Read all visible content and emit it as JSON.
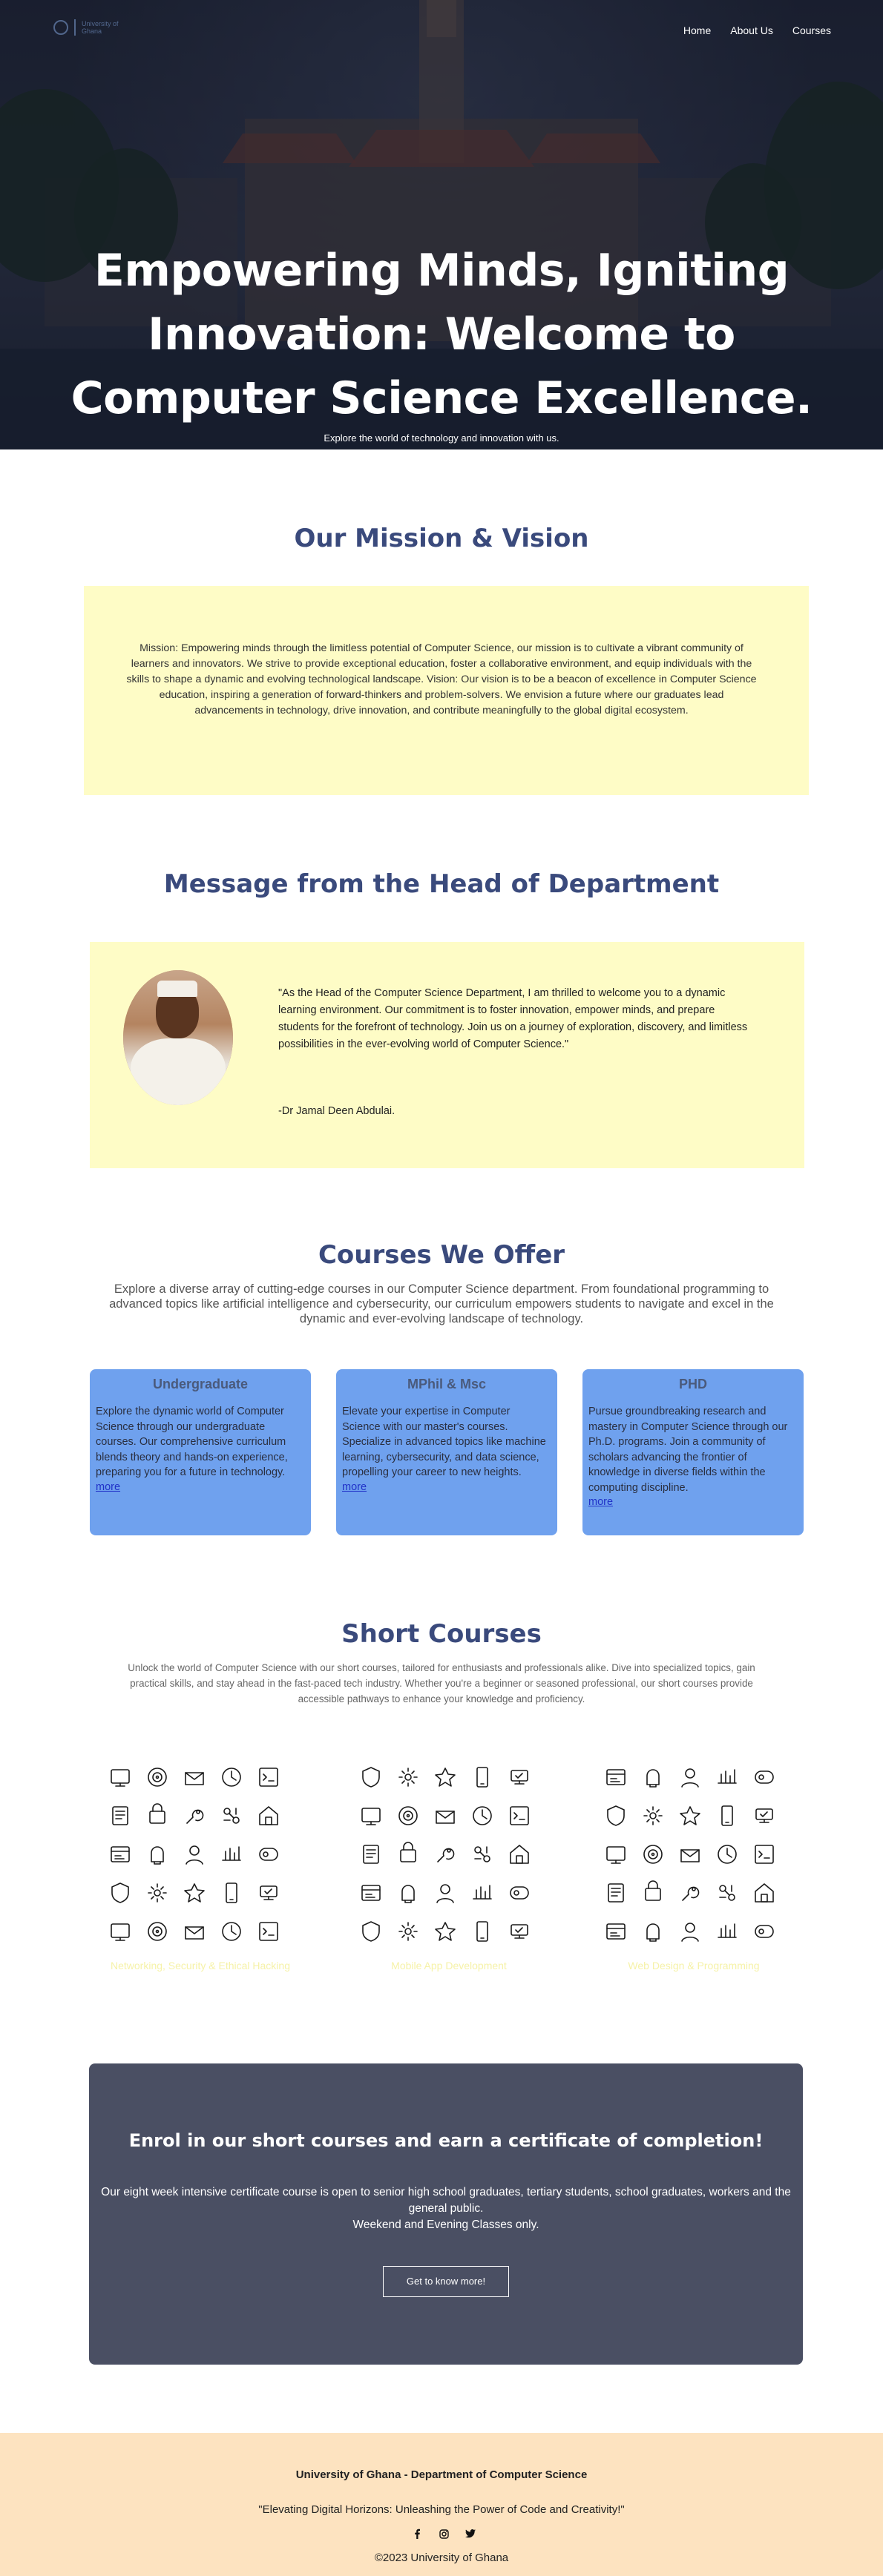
{
  "nav": {
    "logo_text_1": "University of",
    "logo_text_2": "Ghana",
    "links": [
      "Home",
      "About Us",
      "Courses"
    ]
  },
  "hero": {
    "title": "Empowering Minds, Igniting Innovation: Welcome to Computer Science Excellence.",
    "subtitle": "Explore the world of technology and innovation with us."
  },
  "mission": {
    "title": "Our Mission & Vision",
    "text": "Mission: Empowering minds through the limitless potential of Computer Science, our mission is to cultivate a vibrant community of learners and innovators. We strive to provide exceptional education, foster a collaborative environment, and equip individuals with the skills to shape a dynamic and evolving technological landscape. Vision: Our vision is to be a beacon of excellence in Computer Science education, inspiring a generation of forward-thinkers and problem-solvers. We envision a future where our graduates lead advancements in technology, drive innovation, and contribute meaningfully to the global digital ecosystem."
  },
  "hod": {
    "title": "Message from the Head of Department",
    "quote": "\"As the Head of the Computer Science Department, I am thrilled to welcome you to a dynamic learning environment. Our commitment is to foster innovation, empower minds, and prepare students for the forefront of technology. Join us on a journey of exploration, discovery, and limitless possibilities in the ever-evolving world of Computer Science.\"",
    "signature": "-Dr Jamal Deen Abdulai."
  },
  "courses": {
    "title": "Courses We Offer",
    "description": "Explore a diverse array of cutting-edge courses in our Computer Science department. From foundational programming to advanced topics like artificial intelligence and cybersecurity, our curriculum empowers students to navigate and excel in the dynamic and ever-evolving landscape of technology.",
    "cards": [
      {
        "title": "Undergraduate",
        "text": "Explore the dynamic world of Computer Science through our undergraduate courses. Our comprehensive curriculum blends theory and hands-on experience, preparing you for a future in technology.",
        "more": "more"
      },
      {
        "title": "MPhil & Msc",
        "text": "Elevate your expertise in Computer Science with our master's courses. Specialize in advanced topics like machine learning, cybersecurity, and data science, propelling your career to new heights.",
        "more": "more"
      },
      {
        "title": "PHD",
        "text": "Pursue groundbreaking research and mastery in Computer Science through our Ph.D. programs. Join a community of scholars advancing the frontier of knowledge in diverse fields within the computing discipline.",
        "more": "more"
      }
    ]
  },
  "short_courses": {
    "title": "Short Courses",
    "description": "Unlock the world of Computer Science with our short courses, tailored for enthusiasts and professionals alike. Dive into specialized topics, gain practical skills, and stay ahead in the fast-paced tech industry. Whether you're a beginner or seasoned professional, our short courses provide accessible pathways to enhance your knowledge and proficiency.",
    "groups": [
      {
        "label": "Networking, Security & Ethical Hacking"
      },
      {
        "label": "Mobile App Development"
      },
      {
        "label": "Web Design & Programming"
      }
    ]
  },
  "enrol": {
    "title": "Enrol in our short courses and earn a certificate of completion!",
    "text_1": "Our eight week intensive certificate course is open to senior high school graduates, tertiary students, school graduates, workers and the general public.",
    "text_2": "Weekend and Evening Classes only.",
    "button": "Get to know more!"
  },
  "footer": {
    "name": "University of Ghana - Department of Computer Science",
    "slogan": "\"Elevating Digital Horizons: Unleashing the Power of Code and Creativity!\"",
    "social_icons": [
      "facebook-icon",
      "instagram-icon",
      "twitter-icon"
    ],
    "copyright": "©2023 University of Ghana"
  },
  "colors": {
    "heading": "#3a4a7c",
    "highlight_box": "#fefcc6",
    "card": "#6fa1ee",
    "enrol_box": "#4a4f63",
    "footer": "#fde3c0"
  }
}
